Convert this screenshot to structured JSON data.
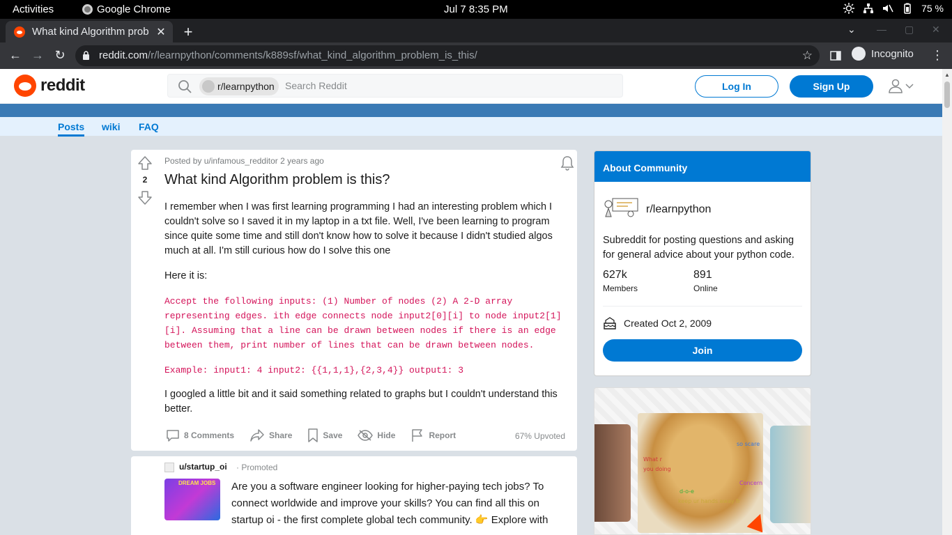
{
  "os": {
    "activities": "Activities",
    "app_name": "Google Chrome",
    "clock": "Jul 7  8:35 PM",
    "battery": "75 %"
  },
  "browser": {
    "tab_title": "What kind Algorithm prob",
    "url_host": "reddit.com",
    "url_path": "/r/learnpython/comments/k889sf/what_kind_algorithm_problem_is_this/",
    "profile": "Incognito"
  },
  "header": {
    "logo": "reddit",
    "search_chip": "r/learnpython",
    "search_placeholder": "Search Reddit",
    "login": "Log In",
    "signup": "Sign Up"
  },
  "subnav": {
    "items": [
      "Posts",
      "wiki",
      "FAQ"
    ]
  },
  "post": {
    "votes": "2",
    "meta": "Posted by u/infamous_redditor 2 years ago",
    "title": "What kind Algorithm problem is this?",
    "p1": "I remember when I was first learning programming I had an interesting problem which I couldn't solve so I saved it in my laptop in a txt file. Well, I've been learning to program since quite some time and still don't know how to solve it because I didn't studied algos much at all. I'm still curious how do I solve this one",
    "p2": "Here it is:",
    "code1": "Accept the following inputs: (1) Number of nodes (2) A 2-D array representing edges. ith edge connects node input2[0][i] to node input2[1][i]. Assuming that a line can be drawn between nodes if there is an edge between them, print number of lines that can be drawn between nodes.",
    "code2": "Example: input1: 4 input2: {{1,1,1},{2,3,4}} output1: 3",
    "p3": "I googled a little bit and it said something related to graphs but I couldn't understand this better.",
    "actions": {
      "comments": "8 Comments",
      "share": "Share",
      "save": "Save",
      "hide": "Hide",
      "report": "Report"
    },
    "upvoted": "67% Upvoted"
  },
  "promo": {
    "user": "u/startup_oi",
    "label": "· Promoted",
    "thumb_text": "DREAM JOBS",
    "text": "Are you a software engineer looking for higher-paying tech jobs? To connect worldwide and improve your skills? You can find all this on startup oi - the first complete global tech community. 👉 Explore with"
  },
  "about": {
    "header": "About Community",
    "name": "r/learnpython",
    "desc": "Subreddit for posting questions and asking for general advice about your python code.",
    "members": "627k",
    "members_label": "Members",
    "online": "891",
    "online_label": "Online",
    "created": "Created Oct 2, 2009",
    "join": "Join"
  },
  "ad": {
    "t1": "so scare",
    "t2": "What r",
    "t3": "you doing",
    "t4": "Concern",
    "t5": "d-o-e",
    "t6": "keep ur hands away fr"
  }
}
